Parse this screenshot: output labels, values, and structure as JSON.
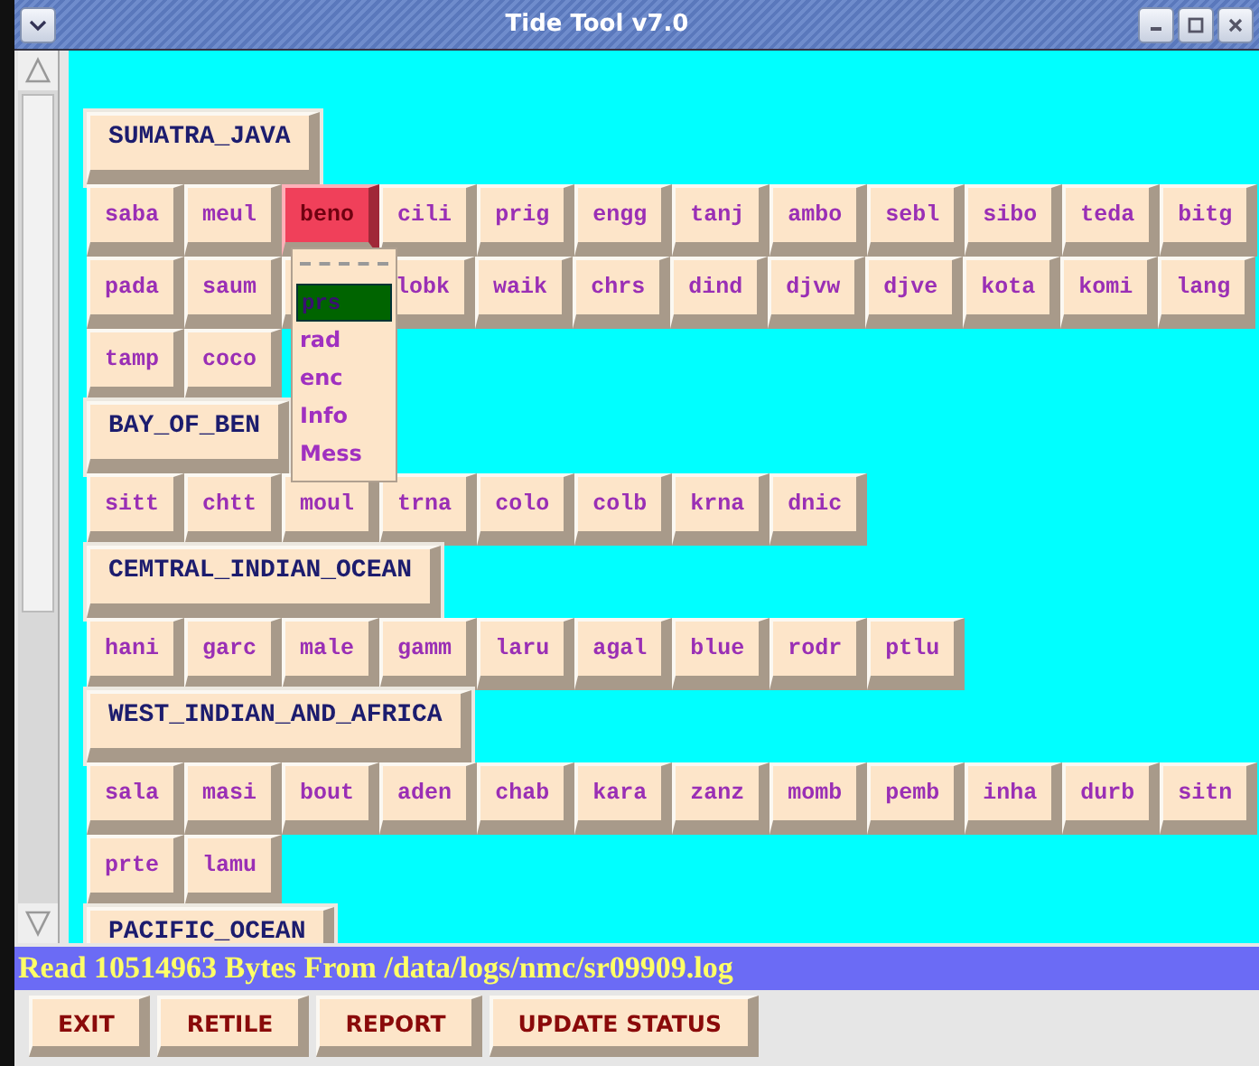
{
  "window": {
    "title": "Tide Tool v7.0"
  },
  "groups": [
    {
      "name": "SUMATRA_JAVA",
      "rows": [
        {
          "items": [
            {
              "kind": "station",
              "label": "saba",
              "selected": false
            },
            {
              "kind": "station",
              "label": "meul",
              "selected": false
            },
            {
              "kind": "station",
              "label": "beno",
              "selected": true
            },
            {
              "kind": "station",
              "label": "cili",
              "selected": false
            },
            {
              "kind": "station",
              "label": "prig",
              "selected": false
            },
            {
              "kind": "station",
              "label": "engg",
              "selected": false
            },
            {
              "kind": "station",
              "label": "tanj",
              "selected": false
            },
            {
              "kind": "station",
              "label": "ambo",
              "selected": false
            },
            {
              "kind": "station",
              "label": "sebl",
              "selected": false
            },
            {
              "kind": "station",
              "label": "sibo",
              "selected": false
            },
            {
              "kind": "station",
              "label": "teda",
              "selected": false
            },
            {
              "kind": "station",
              "label": "bitg",
              "selected": false
            }
          ]
        },
        {
          "items": [
            {
              "kind": "station",
              "label": "pada",
              "selected": false
            },
            {
              "kind": "station",
              "label": "saum",
              "selected": false
            },
            {
              "kind": "covered"
            },
            {
              "kind": "station",
              "label": "lobk",
              "selected": false
            },
            {
              "kind": "station",
              "label": "waik",
              "selected": false
            },
            {
              "kind": "station",
              "label": "chrs",
              "selected": false
            },
            {
              "kind": "station",
              "label": "dind",
              "selected": false
            },
            {
              "kind": "station",
              "label": "djvw",
              "selected": false
            },
            {
              "kind": "station",
              "label": "djve",
              "selected": false
            },
            {
              "kind": "station",
              "label": "kota",
              "selected": false
            },
            {
              "kind": "station",
              "label": "komi",
              "selected": false
            },
            {
              "kind": "station",
              "label": "lang",
              "selected": false
            }
          ]
        },
        {
          "items": [
            {
              "kind": "station",
              "label": "tamp",
              "selected": false
            },
            {
              "kind": "station",
              "label": "coco",
              "selected": false
            }
          ]
        }
      ]
    },
    {
      "name": "BAY_OF_BEN",
      "rows": [
        {
          "items": [
            {
              "kind": "station",
              "label": "sitt",
              "selected": false
            },
            {
              "kind": "station",
              "label": "chtt",
              "selected": false
            },
            {
              "kind": "station",
              "label": "moul",
              "selected": false
            },
            {
              "kind": "station",
              "label": "trna",
              "selected": false
            },
            {
              "kind": "station",
              "label": "colo",
              "selected": false
            },
            {
              "kind": "station",
              "label": "colb",
              "selected": false
            },
            {
              "kind": "station",
              "label": "krna",
              "selected": false
            },
            {
              "kind": "station",
              "label": "dnic",
              "selected": false
            }
          ]
        }
      ]
    },
    {
      "name": "CEMTRAL_INDIAN_OCEAN",
      "rows": [
        {
          "items": [
            {
              "kind": "station",
              "label": "hani",
              "selected": false
            },
            {
              "kind": "station",
              "label": "garc",
              "selected": false
            },
            {
              "kind": "station",
              "label": "male",
              "selected": false
            },
            {
              "kind": "station",
              "label": "gamm",
              "selected": false
            },
            {
              "kind": "station",
              "label": "laru",
              "selected": false
            },
            {
              "kind": "station",
              "label": "agal",
              "selected": false
            },
            {
              "kind": "station",
              "label": "blue",
              "selected": false
            },
            {
              "kind": "station",
              "label": "rodr",
              "selected": false
            },
            {
              "kind": "station",
              "label": "ptlu",
              "selected": false
            }
          ]
        }
      ]
    },
    {
      "name": "WEST_INDIAN_AND_AFRICA",
      "rows": [
        {
          "items": [
            {
              "kind": "station",
              "label": "sala",
              "selected": false
            },
            {
              "kind": "station",
              "label": "masi",
              "selected": false
            },
            {
              "kind": "station",
              "label": "bout",
              "selected": false
            },
            {
              "kind": "station",
              "label": "aden",
              "selected": false
            },
            {
              "kind": "station",
              "label": "chab",
              "selected": false
            },
            {
              "kind": "station",
              "label": "kara",
              "selected": false
            },
            {
              "kind": "station",
              "label": "zanz",
              "selected": false
            },
            {
              "kind": "station",
              "label": "momb",
              "selected": false
            },
            {
              "kind": "station",
              "label": "pemb",
              "selected": false
            },
            {
              "kind": "station",
              "label": "inha",
              "selected": false
            },
            {
              "kind": "station",
              "label": "durb",
              "selected": false
            },
            {
              "kind": "station",
              "label": "sitn",
              "selected": false
            }
          ]
        },
        {
          "items": [
            {
              "kind": "station",
              "label": "prte",
              "selected": false
            },
            {
              "kind": "station",
              "label": "lamu",
              "selected": false
            }
          ]
        }
      ]
    },
    {
      "name": "PACIFIC_OCEAN"
    }
  ],
  "popup": {
    "items": [
      {
        "label": "prs",
        "selected": true
      },
      {
        "label": "rad",
        "selected": false
      },
      {
        "label": "enc",
        "selected": false
      },
      {
        "label": "Info",
        "selected": false
      },
      {
        "label": "Mess",
        "selected": false
      }
    ]
  },
  "status_bar": "Read 10514963 Bytes From /data/logs/nmc/sr09909.log",
  "buttons": [
    "EXIT",
    "RETILE",
    "REPORT",
    "UPDATE STATUS"
  ]
}
